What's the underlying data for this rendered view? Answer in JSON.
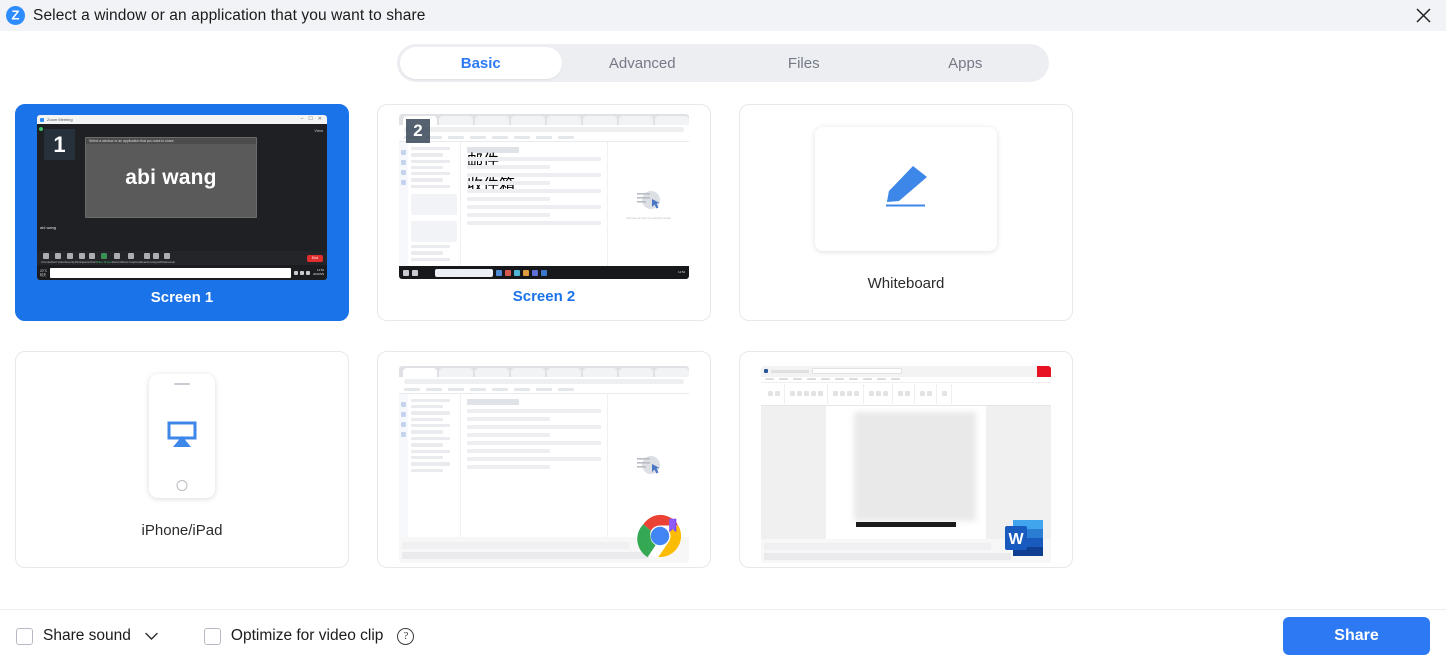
{
  "window": {
    "title": "Select a window or an application that you want to share",
    "logo_icon": "zoom-logo-icon",
    "logo_letter": "Z",
    "close_icon": "close-icon"
  },
  "tabs": [
    {
      "label": "Basic",
      "active": true
    },
    {
      "label": "Advanced",
      "active": false
    },
    {
      "label": "Files",
      "active": false
    },
    {
      "label": "Apps",
      "active": false
    }
  ],
  "share_targets": [
    {
      "label": "Screen 1",
      "type": "screen",
      "selected": true,
      "badge": "1",
      "preview": {
        "app": "Zoom Meeting",
        "participant_name": "abi wang",
        "titlebar_text": "Zoom Meeting",
        "view_label": "View",
        "name_chip": "abi wang",
        "toolbar": [
          "Unmute",
          "Start Video",
          "Security",
          "Participants",
          "Chat",
          "Share Screen",
          "Record",
          "Show Captions",
          "Reactions",
          "Apps",
          "Whiteboards"
        ],
        "end_button": "End",
        "inner_dialog_title": "Select a window or an application that you want to share",
        "taskbar_temp": "20°C",
        "taskbar_weather": "晴天",
        "taskbar_clock": "14:52",
        "taskbar_date": "2023/5/9"
      }
    },
    {
      "label": "Screen 2",
      "type": "screen",
      "selected": false,
      "badge": "2",
      "preview": {
        "app": "Browser - Mail",
        "subject": "邮件 收件箱",
        "empty_state": "Choose an item to read the detail",
        "taskbar_clock": "14:52",
        "taskbar_date": "2023/5/9"
      }
    },
    {
      "label": "Whiteboard",
      "type": "whiteboard",
      "selected": false,
      "icon": "pen-icon"
    },
    {
      "label": "iPhone/iPad",
      "type": "device",
      "selected": false,
      "icon": "airplay-icon"
    },
    {
      "label": "",
      "type": "window",
      "selected": false,
      "app_icon": "chrome-icon"
    },
    {
      "label": "",
      "type": "window",
      "selected": false,
      "app_icon": "word-icon",
      "app_icon_letter": "W"
    }
  ],
  "footer": {
    "share_sound_label": "Share sound",
    "share_sound_checked": false,
    "share_sound_dropdown_icon": "chevron-down-icon",
    "optimize_label": "Optimize for video clip",
    "optimize_checked": false,
    "help_icon": "question-mark-icon",
    "help_glyph": "?",
    "share_button_label": "Share"
  },
  "colors": {
    "accent_blue": "#2d79f3",
    "selected_card_blue": "#1a73e8",
    "header_bg": "#f2f3f7",
    "tabs_bg": "#edeef2"
  }
}
